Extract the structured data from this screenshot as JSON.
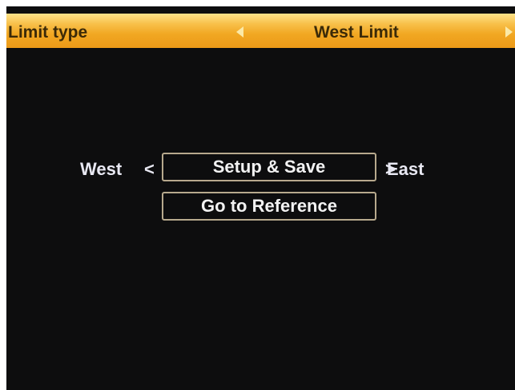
{
  "header": {
    "label": "Limit type",
    "value": "West Limit",
    "left_arrow_icon": "triangle-left",
    "right_arrow_icon": "triangle-right"
  },
  "controls": {
    "west_label": "West",
    "west_chevron": "<",
    "setup_save_label": "Setup & Save",
    "east_chevron": ">",
    "east_label": "East",
    "go_to_reference_label": "Go to Reference"
  },
  "colors": {
    "header_bar": "#f1a722",
    "background": "#0d0d0e",
    "text": "#f2f2f2",
    "button_border": "#b7a98d"
  }
}
